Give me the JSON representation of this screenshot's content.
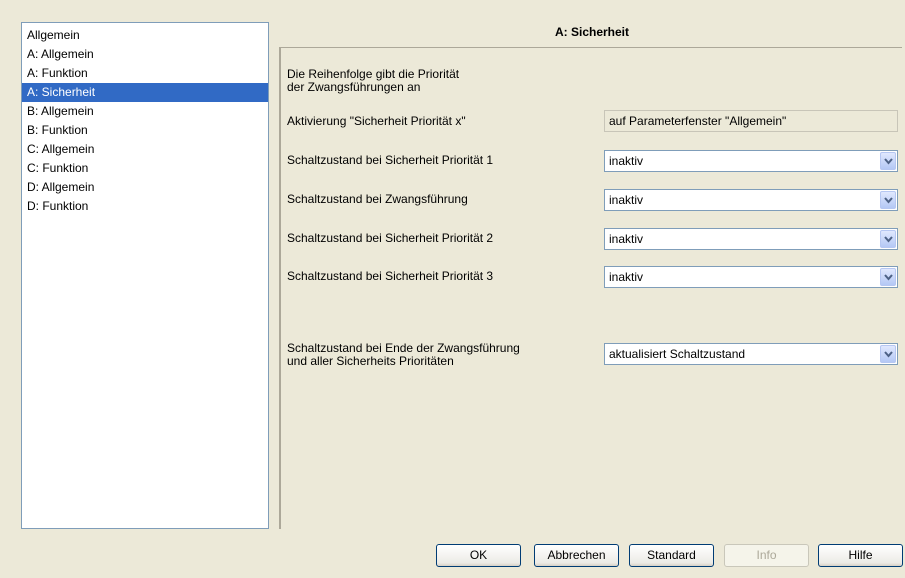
{
  "nav": {
    "items": [
      {
        "label": "Allgemein",
        "selected": false
      },
      {
        "label": "A: Allgemein",
        "selected": false
      },
      {
        "label": "A: Funktion",
        "selected": false
      },
      {
        "label": "A: Sicherheit",
        "selected": true
      },
      {
        "label": "B: Allgemein",
        "selected": false
      },
      {
        "label": "B: Funktion",
        "selected": false
      },
      {
        "label": "C: Allgemein",
        "selected": false
      },
      {
        "label": "C: Funktion",
        "selected": false
      },
      {
        "label": "D: Allgemein",
        "selected": false
      },
      {
        "label": "D: Funktion",
        "selected": false
      }
    ]
  },
  "panel": {
    "title": "A: Sicherheit",
    "intro_line1": "Die Reihenfolge gibt die Priorität",
    "intro_line2": "der Zwangsführungen an",
    "activation_label": "Aktivierung \"Sicherheit Priorität x\"",
    "activation_value": "auf Parameterfenster \"Allgemein\"",
    "rows": [
      {
        "label": "Schaltzustand bei Sicherheit Priorität 1",
        "value": "inaktiv"
      },
      {
        "label": "Schaltzustand bei Zwangsführung",
        "value": "inaktiv"
      },
      {
        "label": "Schaltzustand bei Sicherheit Priorität 2",
        "value": "inaktiv"
      },
      {
        "label": "Schaltzustand bei Sicherheit Priorität 3",
        "value": "inaktiv"
      }
    ],
    "end_label_line1": "Schaltzustand bei Ende der Zwangsführung",
    "end_label_line2": "und aller Sicherheits Prioritäten",
    "end_value": "aktualisiert Schaltzustand"
  },
  "buttons": {
    "ok": "OK",
    "cancel": "Abbrechen",
    "default": "Standard",
    "info": "Info",
    "help": "Hilfe"
  },
  "colors": {
    "selection": "#316ac5",
    "dialog_bg": "#ece9d8",
    "dropdown_accent": "#4d6185"
  }
}
